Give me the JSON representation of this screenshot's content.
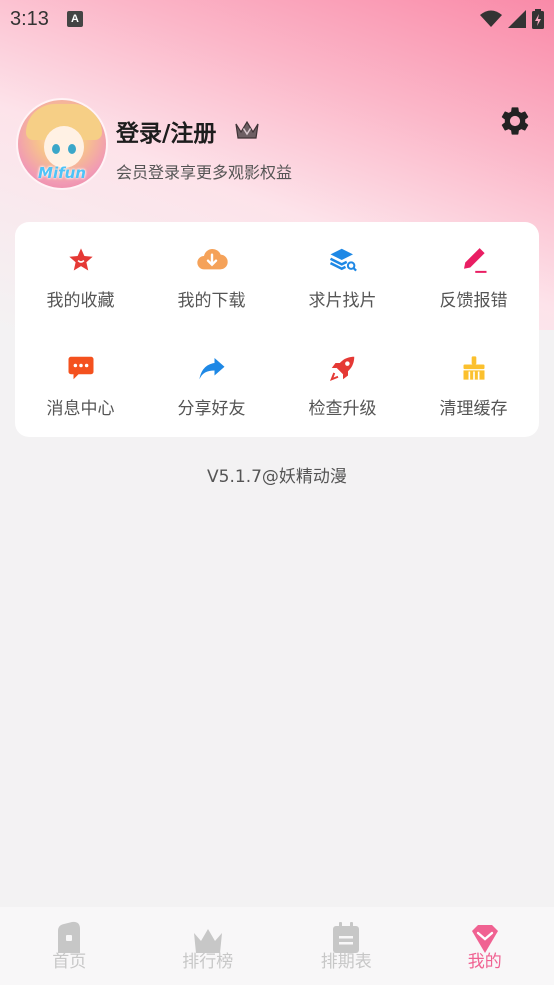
{
  "status_bar": {
    "time": "3:13",
    "app_icon_letter": "A"
  },
  "profile": {
    "title": "登录/注册",
    "subtitle": "会员登录享更多观影权益",
    "avatar_text": "Mifun"
  },
  "menu": {
    "items": [
      {
        "label": "我的收藏",
        "icon": "star-icon",
        "color": "#e53935"
      },
      {
        "label": "我的下载",
        "icon": "download-icon",
        "color": "#f5a259"
      },
      {
        "label": "求片找片",
        "icon": "search-layers-icon",
        "color": "#1e88e5"
      },
      {
        "label": "反馈报错",
        "icon": "edit-pen-icon",
        "color": "#e91e63"
      },
      {
        "label": "消息中心",
        "icon": "chat-icon",
        "color": "#f4511e"
      },
      {
        "label": "分享好友",
        "icon": "share-icon",
        "color": "#1e88e5"
      },
      {
        "label": "检查升级",
        "icon": "rocket-icon",
        "color": "#e53935"
      },
      {
        "label": "清理缓存",
        "icon": "broom-icon",
        "color": "#fbc02d"
      }
    ]
  },
  "version": "V5.1.7@妖精动漫",
  "tabbar": {
    "tabs": [
      {
        "label": "首页",
        "icon": "home-icon",
        "active": false
      },
      {
        "label": "排行榜",
        "icon": "crown-icon",
        "active": false
      },
      {
        "label": "排期表",
        "icon": "calendar-icon",
        "active": false
      },
      {
        "label": "我的",
        "icon": "heart-diamond-icon",
        "active": true
      }
    ],
    "active_color": "#f06292",
    "inactive_color": "#c7c7c7"
  }
}
